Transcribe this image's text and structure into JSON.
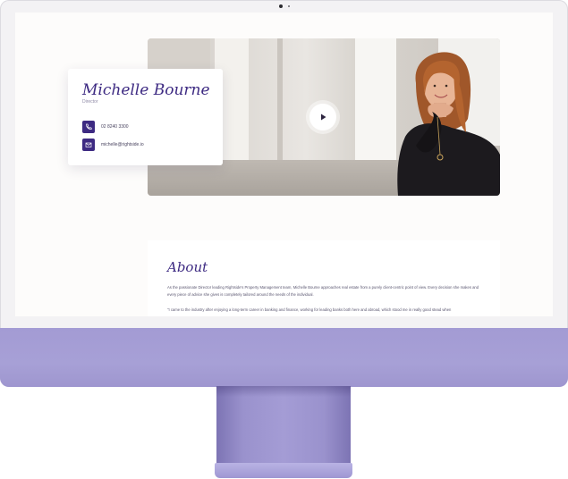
{
  "profile": {
    "name": "Michelle Bourne",
    "role": "Director",
    "phone": "02 8240 3300",
    "email": "michelle@rightside.io"
  },
  "video": {
    "play_icon": "play-icon"
  },
  "about": {
    "title": "About",
    "paragraph_1": "As the passionate Director leading Rightside's Property Management team, Michelle Bourne approaches real estate from a purely client-centric point of view. Every decision she makes and every piece of advice she gives is completely tailored around the needs of the individual.",
    "paragraph_2": "\"I came to the industry after enjoying a long-term career in banking and finance, working for leading banks both here and abroad, which stood me in really good stead when"
  },
  "icons": {
    "phone": "phone-icon",
    "email": "mail-icon"
  },
  "colors": {
    "accent": "#3d2a82",
    "monitor_chin": "#a39bd4"
  }
}
